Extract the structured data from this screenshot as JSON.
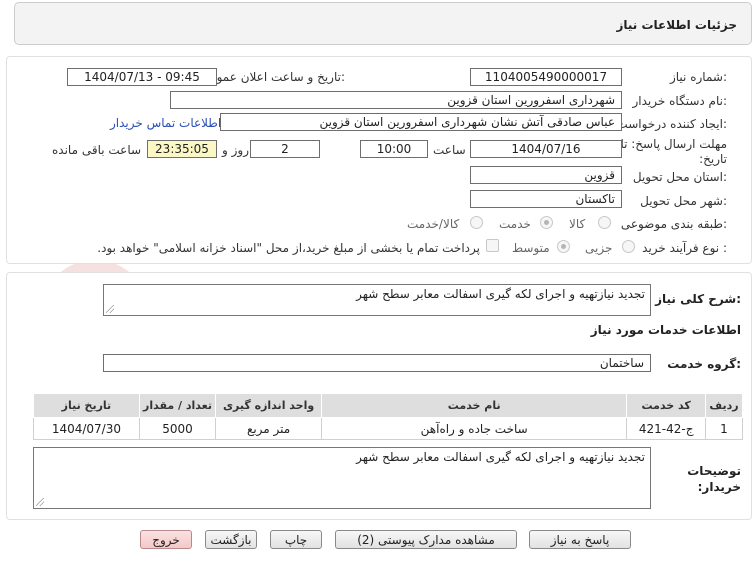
{
  "header": {
    "title": "جزئیات اطلاعات نیاز"
  },
  "form": {
    "need_number_label": "شماره نیاز:",
    "need_number": "1104005490000017",
    "announce_label": "تاریخ و ساعت اعلان عمومی:",
    "announce_value": "1404/07/13 - 09:45",
    "buyer_label": "نام دستگاه خریدار:",
    "buyer_value": "شهرداری اسفرورین استان قزوین",
    "creator_label": "ایجاد کننده درخواست:",
    "creator_value": "عباس صادقی آتش نشان شهرداری اسفرورین استان قزوین",
    "contact_link": "اطلاعات تماس خریدار",
    "deadline_label": "مهلت ارسال پاسخ: تا تاریخ:",
    "deadline_date": "1404/07/16",
    "time_label": "ساعت",
    "deadline_time": "10:00",
    "days_value": "2",
    "days_label": "روز و",
    "remaining_time": "23:35:05",
    "remaining_label": "ساعت باقی مانده",
    "province_label": "استان محل تحویل:",
    "province_value": "قزوین",
    "city_label": "شهر محل تحویل:",
    "city_value": "تاکستان",
    "category_label": "طبقه بندی موضوعی:",
    "category_options": [
      "کالا",
      "خدمت",
      "کالا/خدمت"
    ],
    "category_selected": "خدمت",
    "process_label": "نوع فرآیند خرید :",
    "process_options": [
      "جزیی",
      "متوسط"
    ],
    "process_selected": "متوسط",
    "payment_note": "پرداخت تمام یا بخشی از مبلغ خرید،از محل \"اسناد خزانه اسلامی\" خواهد بود."
  },
  "description": {
    "label": "شرح کلی نیاز:",
    "value": "تجدید نیازتهیه و اجرای لکه گیری اسفالت معابر سطح شهر"
  },
  "services": {
    "section_title": "اطلاعات خدمات مورد نیاز",
    "group_label": "گروه خدمت:",
    "group_value": "ساختمان",
    "columns": [
      "ردیف",
      "کد خدمت",
      "نام خدمت",
      "واحد اندازه گیری",
      "تعداد / مقدار",
      "تاریخ نیاز"
    ],
    "rows": [
      [
        "1",
        "ج-42-421",
        "ساخت جاده و راه‌آهن",
        "متر مربع",
        "5000",
        "1404/07/30"
      ]
    ]
  },
  "buyer_notes": {
    "label": "توضیحات خریدار:",
    "value": "تجدید نیازتهیه و اجرای لکه گیری اسفالت معابر سطح شهر"
  },
  "buttons": {
    "reply": "پاسخ به نیاز",
    "attachments": "مشاهده مدارک پیوستی (2)",
    "print": "چاپ",
    "back": "بازگشت",
    "exit": "خروج"
  },
  "watermark": {
    "text": "AriaTender.net"
  },
  "colors": {
    "link": "#2a4fb5",
    "remaining_bg": "#fcf8c6",
    "header_bg": "#f3f3f3",
    "table_header_bg": "#dedede",
    "exit_button": "#f4c8c8"
  }
}
